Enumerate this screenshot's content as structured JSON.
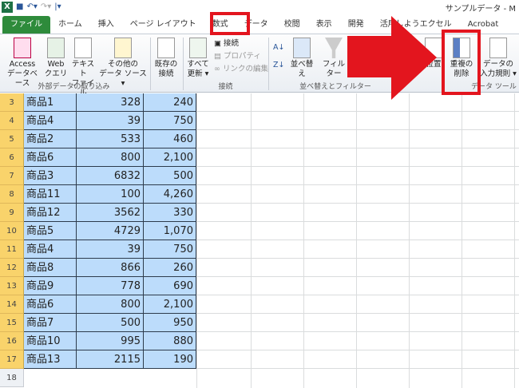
{
  "window": {
    "title": "サンプルデータ - M",
    "quick_access": [
      "save-icon",
      "undo-icon",
      "redo-icon"
    ]
  },
  "tabs": [
    "ファイル",
    "ホーム",
    "挿入",
    "ページ レイアウト",
    "数式",
    "データ",
    "校閲",
    "表示",
    "開発",
    "活用しようエクセル",
    "Acrobat"
  ],
  "active_tab": "データ",
  "ribbon": {
    "external": {
      "label": "外部データの取り込み",
      "buttons": [
        [
          "Access",
          "データベース"
        ],
        [
          "Web",
          "クエリ"
        ],
        [
          "テキスト",
          "ファイル"
        ],
        [
          "その他の",
          "データ ソース ▾"
        ]
      ]
    },
    "existing": [
      "既存の",
      "接続"
    ],
    "connections": {
      "label": "接続",
      "refresh": [
        "すべて",
        "更新 ▾"
      ],
      "items": [
        "接続",
        "プロパティ",
        "リンクの編集"
      ]
    },
    "sort_filter": {
      "label": "並べ替えとフィルター",
      "sort": "並べ替え",
      "filter": "フィルター",
      "text_to_columns": "位置"
    },
    "data_tools": {
      "label": "データ ツール",
      "remove_duplicates": [
        "重複の",
        "削除"
      ],
      "validation": [
        "データの",
        "入力規則 ▾"
      ]
    }
  },
  "rows": [
    {
      "n": "3",
      "a": "商品1",
      "b": "328",
      "c": "240"
    },
    {
      "n": "4",
      "a": "商品4",
      "b": "39",
      "c": "750"
    },
    {
      "n": "5",
      "a": "商品2",
      "b": "533",
      "c": "460"
    },
    {
      "n": "6",
      "a": "商品6",
      "b": "800",
      "c": "2,100"
    },
    {
      "n": "7",
      "a": "商品3",
      "b": "6832",
      "c": "500"
    },
    {
      "n": "8",
      "a": "商品11",
      "b": "100",
      "c": "4,260"
    },
    {
      "n": "9",
      "a": "商品12",
      "b": "3562",
      "c": "330"
    },
    {
      "n": "10",
      "a": "商品5",
      "b": "4729",
      "c": "1,070"
    },
    {
      "n": "11",
      "a": "商品4",
      "b": "39",
      "c": "750"
    },
    {
      "n": "12",
      "a": "商品8",
      "b": "866",
      "c": "260"
    },
    {
      "n": "13",
      "a": "商品9",
      "b": "778",
      "c": "690"
    },
    {
      "n": "14",
      "a": "商品6",
      "b": "800",
      "c": "2,100"
    },
    {
      "n": "15",
      "a": "商品7",
      "b": "500",
      "c": "950"
    },
    {
      "n": "16",
      "a": "商品10",
      "b": "995",
      "c": "880"
    },
    {
      "n": "17",
      "a": "商品13",
      "b": "2115",
      "c": "190"
    }
  ],
  "last_row": "18",
  "colors": {
    "highlight": "#e3151e",
    "selection": "#bcdcfb",
    "row_header_selected": "#f9d36b"
  }
}
